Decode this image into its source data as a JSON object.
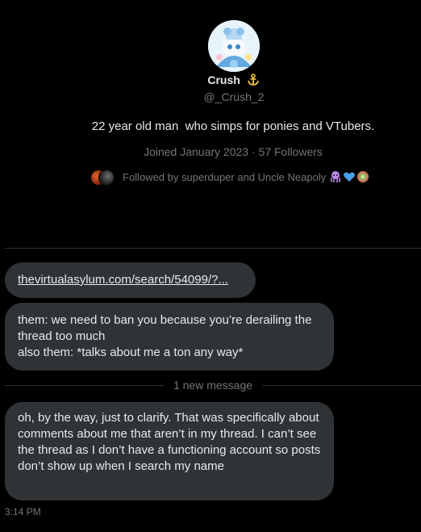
{
  "profile": {
    "display_name": "Crush",
    "badge_icon": "anchor-emoji",
    "handle": "@_Crush_2",
    "bio": "22 year old man  who simps for ponies and VTubers.",
    "joined": "Joined January 2023",
    "separator": "·",
    "followers": "57 Followers",
    "followed_by": "Followed by superduper and Uncle Neapoly"
  },
  "conversation": {
    "link": "thevirtualasylum.com/search/54099/?...",
    "message1": {
      "line1": "them: we need to ban you because you’re derailing the thread too much",
      "line2": "also them: *talks about me a ton any way*"
    },
    "new_message_label": "1 new message",
    "message2": "oh, by the way, just to clarify. That was specifically about comments about me that aren’t in my thread. I can’t see the thread as I don’t have a functioning account so posts don’t show up when I search my name",
    "timestamp": "3:14 PM"
  },
  "colors": {
    "background": "#000000",
    "bubble": "#2f3336",
    "text": "#e7e9ea",
    "muted": "#71767b",
    "divider": "#2f3336"
  }
}
